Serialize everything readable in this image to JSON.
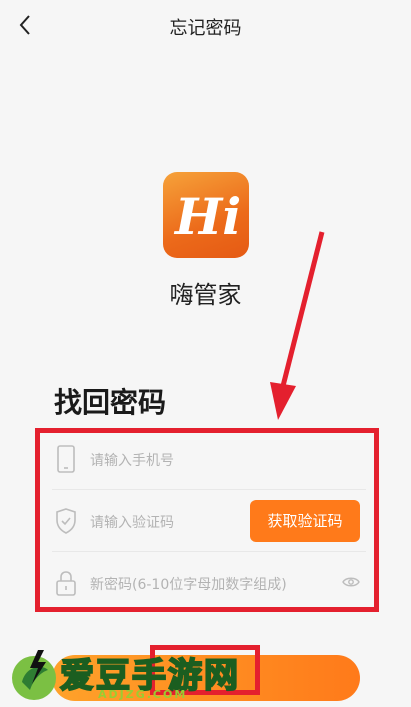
{
  "header": {
    "title": "忘记密码",
    "back_icon": "chevron-left-icon"
  },
  "app": {
    "name": "嗨管家",
    "logo_text": "Hi"
  },
  "section": {
    "title": "找回密码"
  },
  "form": {
    "phone_placeholder": "请输入手机号",
    "code_placeholder": "请输入验证码",
    "code_button": "获取验证码",
    "password_placeholder": "新密码(6-10位字母加数字组成)"
  },
  "colors": {
    "accent": "#ff7a1a",
    "annotation": "#e4202e"
  },
  "watermark": {
    "title": "爱豆手游网",
    "subtitle": "ADJZG.COM"
  }
}
